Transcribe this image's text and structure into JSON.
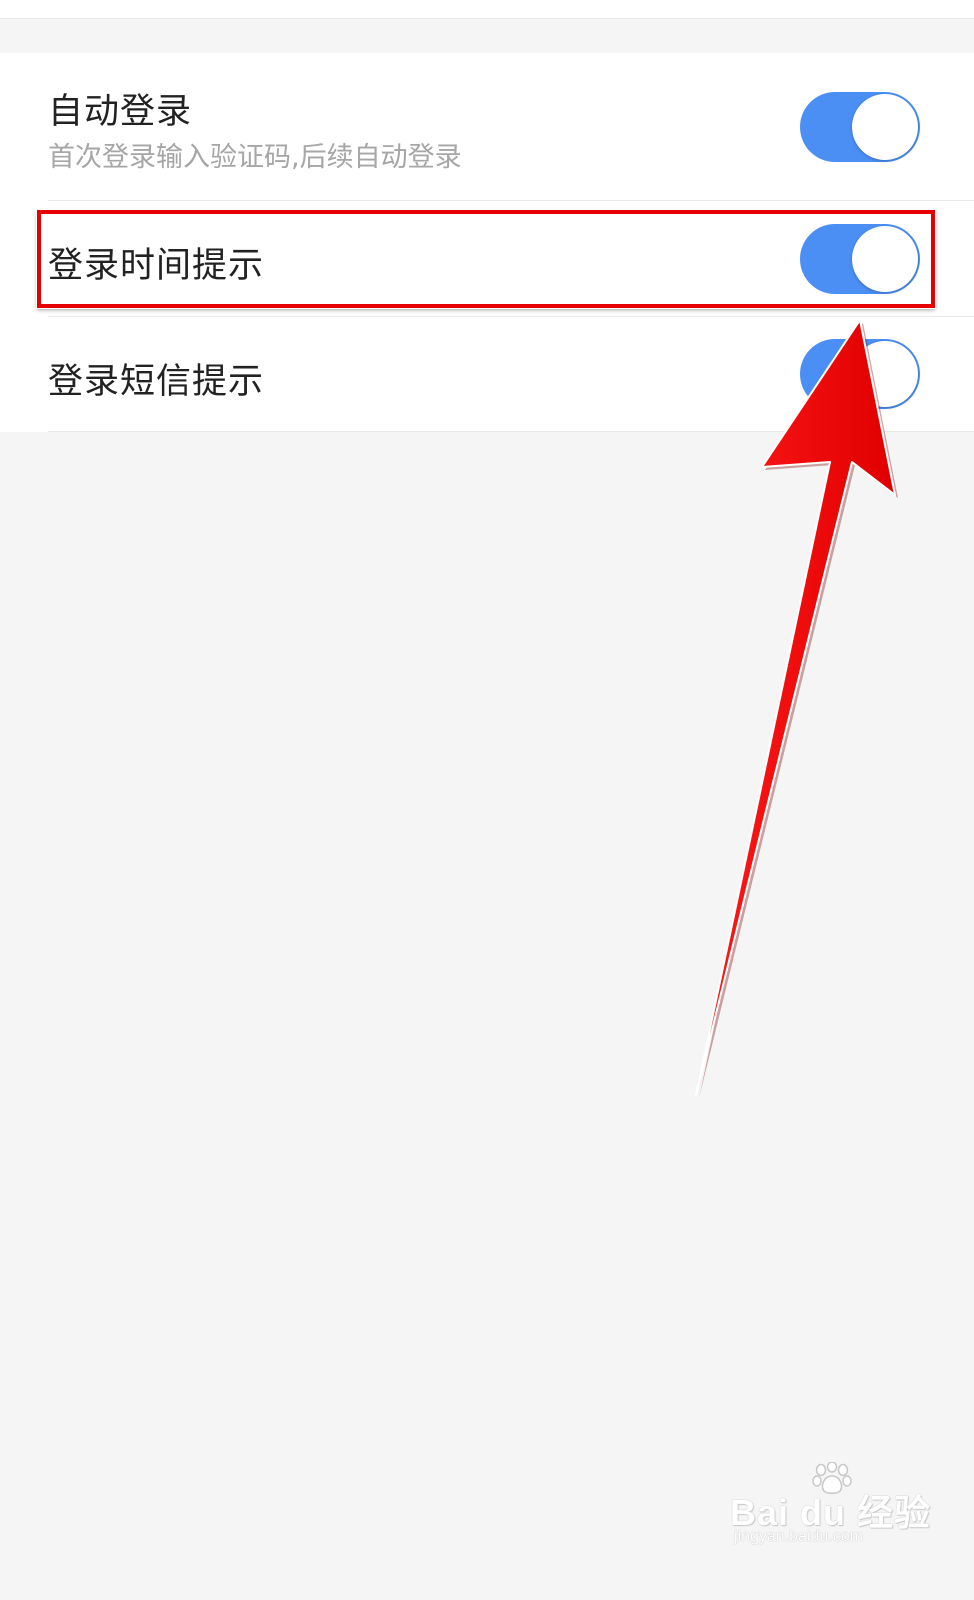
{
  "settings": [
    {
      "title": "自动登录",
      "subtitle": "首次登录输入验证码,后续自动登录",
      "enabled": true
    },
    {
      "title": "登录时间提示",
      "enabled": true,
      "highlighted": true
    },
    {
      "title": "登录短信提示",
      "enabled": true
    }
  ],
  "annotation": {
    "highlight_color": "#e60000",
    "arrow_color": "#ff0000",
    "arrow_icon": "red-arrow-icon"
  },
  "colors": {
    "toggle_on": "#4b8ff5",
    "page_background": "#f5f5f5",
    "title_text": "#222222",
    "subtitle_text": "#a6a6a6"
  },
  "watermark": {
    "brand": "Bai du 经验",
    "url": "jingyan.baidu.com",
    "icon": "paw-icon"
  }
}
